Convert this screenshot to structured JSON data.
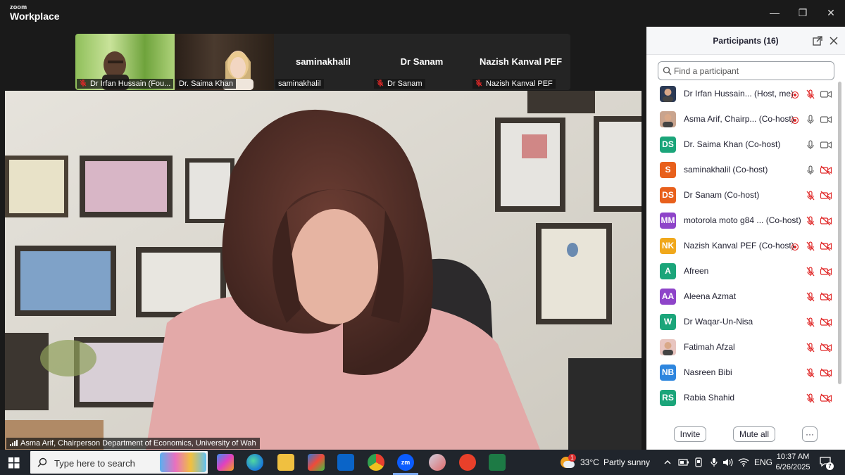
{
  "app": {
    "logo_top": "zoom",
    "logo_bottom": "Workplace"
  },
  "window": {
    "minimize": "—",
    "restore": "❐",
    "close": "✕"
  },
  "gallery": {
    "tiles": [
      {
        "name": "Dr Irfan Hussain (Fou...",
        "type": "video",
        "muted": true
      },
      {
        "name": "Dr. Saima Khan",
        "type": "video",
        "muted": false
      },
      {
        "name": "saminakhalil",
        "big": "saminakhalil",
        "type": "name",
        "muted": false
      },
      {
        "name": "Dr Sanam",
        "big": "Dr Sanam",
        "type": "name",
        "muted": true
      },
      {
        "name": "Nazish Kanval PEF",
        "big": "Nazish Kanval PEF",
        "type": "name",
        "muted": true
      }
    ]
  },
  "main_video": {
    "speaker_label": "Asma Arif, Chairperson Department of Economics, University of Wah"
  },
  "participants": {
    "title": "Participants (16)",
    "search_placeholder": "Find a participant",
    "items": [
      {
        "initials": "",
        "name": "Dr Irfan Hussain... (Host, me)",
        "color": "#2b3a55",
        "photo": true,
        "rec": true,
        "mic": "off",
        "cam": "on"
      },
      {
        "initials": "",
        "name": "Asma Arif, Chairp... (Co-host)",
        "color": "#c9a48e",
        "photo": true,
        "rec": true,
        "mic": "on",
        "cam": "on"
      },
      {
        "initials": "DS",
        "name": "Dr. Saima Khan (Co-host)",
        "color": "#1ba57a",
        "rec": false,
        "mic": "on",
        "cam": "on"
      },
      {
        "initials": "S",
        "name": "saminakhalil (Co-host)",
        "color": "#e8601c",
        "rec": false,
        "mic": "on",
        "cam": "off"
      },
      {
        "initials": "DS",
        "name": "Dr Sanam (Co-host)",
        "color": "#e8601c",
        "rec": false,
        "mic": "off",
        "cam": "off"
      },
      {
        "initials": "MM",
        "name": "motorola moto g84 ...  (Co-host)",
        "color": "#8e44c9",
        "rec": false,
        "mic": "off",
        "cam": "off"
      },
      {
        "initials": "NK",
        "name": "Nazish Kanval PEF (Co-host)",
        "color": "#f0a81c",
        "rec": true,
        "mic": "off",
        "cam": "off"
      },
      {
        "initials": "A",
        "name": "Afreen",
        "color": "#1ba57a",
        "rec": false,
        "mic": "off",
        "cam": "off"
      },
      {
        "initials": "AA",
        "name": "Aleena Azmat",
        "color": "#8e44c9",
        "rec": false,
        "mic": "off",
        "cam": "off"
      },
      {
        "initials": "W",
        "name": "Dr Waqar-Un-Nisa",
        "color": "#1ba57a",
        "rec": false,
        "mic": "off",
        "cam": "off"
      },
      {
        "initials": "",
        "name": "Fatimah Afzal",
        "color": "#e8c5c0",
        "photo": true,
        "rec": false,
        "mic": "off",
        "cam": "off"
      },
      {
        "initials": "NB",
        "name": "Nasreen Bibi",
        "color": "#2e86de",
        "rec": false,
        "mic": "off",
        "cam": "off"
      },
      {
        "initials": "RS",
        "name": "Rabia Shahid",
        "color": "#1ba57a",
        "rec": false,
        "mic": "off",
        "cam": "off"
      }
    ],
    "invite_label": "Invite",
    "mute_all_label": "Mute all",
    "more_label": "···"
  },
  "taskbar": {
    "search_placeholder": "Type here to search",
    "weather_temp": "33°C",
    "weather_text": "Partly sunny",
    "weather_badge": "1",
    "language": "ENG",
    "time": "10:37 AM",
    "date": "6/26/2025",
    "notification_count": "7",
    "colors": {
      "bg": "#20252c",
      "accent": "#0b5cff"
    }
  }
}
